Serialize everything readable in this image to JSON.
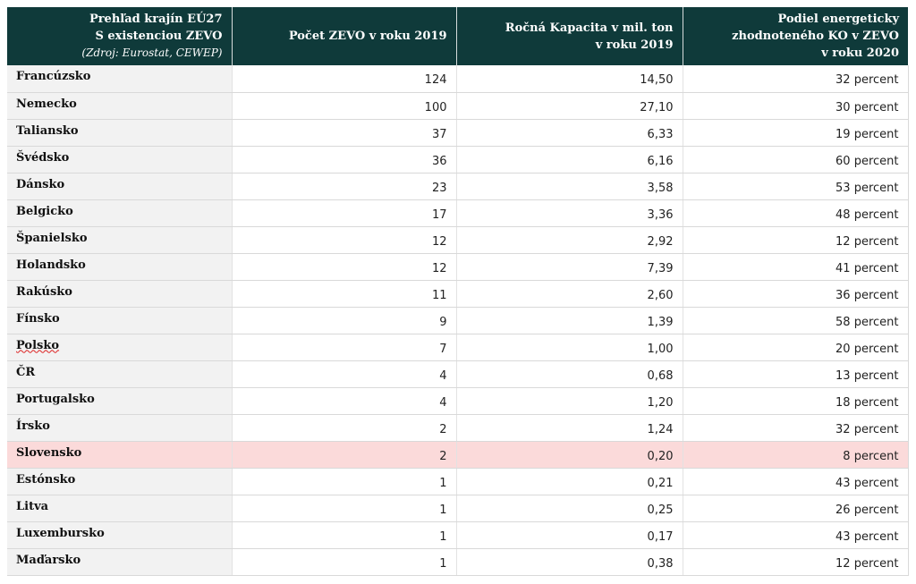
{
  "table": {
    "headers": {
      "country_line1": "Prehľad krajín EÚ27",
      "country_line2": "S existenciou ZEVO",
      "country_source": "(Zdroj: Eurostat, CEWEP)",
      "count": "Počet ZEVO v roku 2019",
      "capacity_line1": "Ročná Kapacita v mil. ton",
      "capacity_line2": "v roku 2019",
      "share_line1": "Podiel energeticky",
      "share_line2": "zhodnoteného KO v ZEVO",
      "share_line3": "v roku 2020"
    },
    "rows": [
      {
        "country": "Francúzsko",
        "count": "124",
        "capacity": "14,50",
        "share": "32 percent"
      },
      {
        "country": "Nemecko",
        "count": "100",
        "capacity": "27,10",
        "share": "30 percent"
      },
      {
        "country": "Taliansko",
        "count": "37",
        "capacity": "6,33",
        "share": "19 percent"
      },
      {
        "country": "Švédsko",
        "count": "36",
        "capacity": "6,16",
        "share": "60 percent"
      },
      {
        "country": "Dánsko",
        "count": "23",
        "capacity": "3,58",
        "share": "53 percent"
      },
      {
        "country": "Belgicko",
        "count": "17",
        "capacity": "3,36",
        "share": "48 percent"
      },
      {
        "country": "Španielsko",
        "count": "12",
        "capacity": "2,92",
        "share": "12 percent"
      },
      {
        "country": "Holandsko",
        "count": "12",
        "capacity": "7,39",
        "share": "41 percent"
      },
      {
        "country": "Rakúsko",
        "count": "11",
        "capacity": "2,60",
        "share": "36 percent"
      },
      {
        "country": "Fínsko",
        "count": "9",
        "capacity": "1,39",
        "share": "58 percent"
      },
      {
        "country": "Polsko",
        "count": "7",
        "capacity": "1,00",
        "share": "20 percent"
      },
      {
        "country": "ČR",
        "count": "4",
        "capacity": "0,68",
        "share": "13 percent"
      },
      {
        "country": "Portugalsko",
        "count": "4",
        "capacity": "1,20",
        "share": "18 percent"
      },
      {
        "country": "Írsko",
        "count": "2",
        "capacity": "1,24",
        "share": "32 percent"
      },
      {
        "country": "Slovensko",
        "count": "2",
        "capacity": "0,20",
        "share": "8 percent"
      },
      {
        "country": "Estónsko",
        "count": "1",
        "capacity": "0,21",
        "share": "43 percent"
      },
      {
        "country": "Litva",
        "count": "1",
        "capacity": "0,25",
        "share": "26 percent"
      },
      {
        "country": "Luxembursko",
        "count": "1",
        "capacity": "0,17",
        "share": "43 percent"
      },
      {
        "country": "Maďarsko",
        "count": "1",
        "capacity": "0,38",
        "share": "12 percent"
      }
    ],
    "highlight_color": "#fbdada",
    "header_color": "#0f3a3a"
  }
}
